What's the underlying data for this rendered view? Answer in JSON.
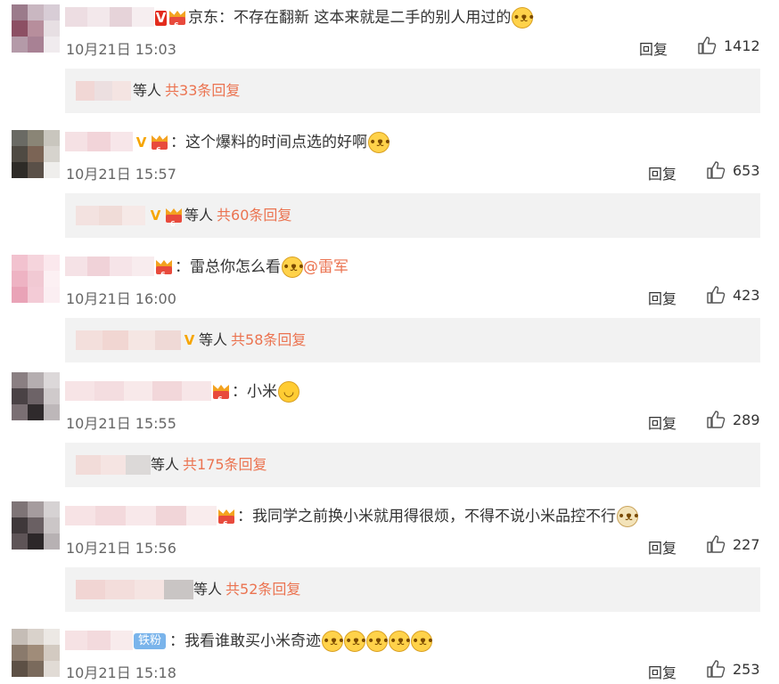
{
  "comments": [
    {
      "text": "京东：不存在翻新 这本来就是二手的别人用过的",
      "time": "10月21日 15:03",
      "reply": "回复",
      "likes": "1412",
      "sub_prefix": "等人",
      "sub_more": "共33条回复"
    },
    {
      "text": "：这个爆料的时间点选的好啊",
      "time": "10月21日 15:57",
      "reply": "回复",
      "likes": "653",
      "sub_prefix": "等人",
      "sub_more": "共60条回复"
    },
    {
      "text": "：雷总你怎么看",
      "mention": "@雷军",
      "time": "10月21日 16:00",
      "reply": "回复",
      "likes": "423",
      "sub_prefix": "等人",
      "sub_more": "共58条回复"
    },
    {
      "text": "：小米",
      "time": "10月21日 15:55",
      "reply": "回复",
      "likes": "289",
      "sub_prefix": "等人",
      "sub_more": "共175条回复"
    },
    {
      "text": "：我同学之前换小米就用得很烦，不得不说小米品控不行",
      "time": "10月21日 15:56",
      "reply": "回复",
      "likes": "227",
      "sub_prefix": "等人",
      "sub_more": "共52条回复"
    },
    {
      "badge": "铁粉",
      "text": "：我看谁敢买小米奇迹",
      "time": "10月21日 15:18",
      "reply": "回复",
      "likes": "253"
    }
  ],
  "icons": {
    "verified": "V",
    "like": "thumbs-up-icon",
    "crown": "member-crown-icon",
    "emoji": "doge-emoji-icon"
  },
  "colors": {
    "link": "#eb7350",
    "sub_bg": "#f2f2f2",
    "verified": "#f6a500"
  }
}
